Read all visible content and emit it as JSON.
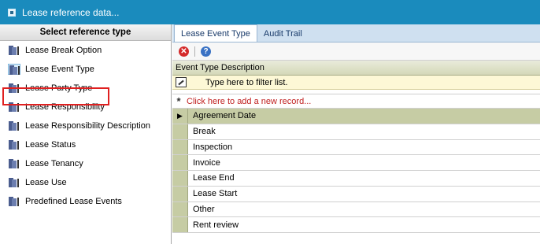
{
  "window": {
    "title": "Lease reference data..."
  },
  "sidebar": {
    "header": "Select reference type",
    "items": [
      {
        "label": "Lease Break Option"
      },
      {
        "label": "Lease Event Type"
      },
      {
        "label": "Lease Party Type"
      },
      {
        "label": "Lease Responsibility"
      },
      {
        "label": "Lease Responsibility Description"
      },
      {
        "label": "Lease Status"
      },
      {
        "label": "Lease Tenancy"
      },
      {
        "label": "Lease Use"
      },
      {
        "label": "Predefined Lease Events"
      }
    ],
    "selected_index": 1
  },
  "tabs": [
    {
      "label": "Lease Event Type"
    },
    {
      "label": "Audit Trail"
    }
  ],
  "toolbar": {
    "delete_icon": "delete-icon",
    "help_icon": "help-icon"
  },
  "grid": {
    "column_header": "Event Type Description",
    "filter_placeholder": "Type here to filter list.",
    "add_record_text": "Click here to add a new record...",
    "rows": [
      "Agreement Date",
      "Break",
      "Inspection",
      "Invoice",
      "Lease End",
      "Lease Start",
      "Other",
      "Rent review"
    ]
  },
  "colors": {
    "titlebar": "#1a8bbd",
    "highlight": "#e02020",
    "add_record_text": "#c02020"
  }
}
